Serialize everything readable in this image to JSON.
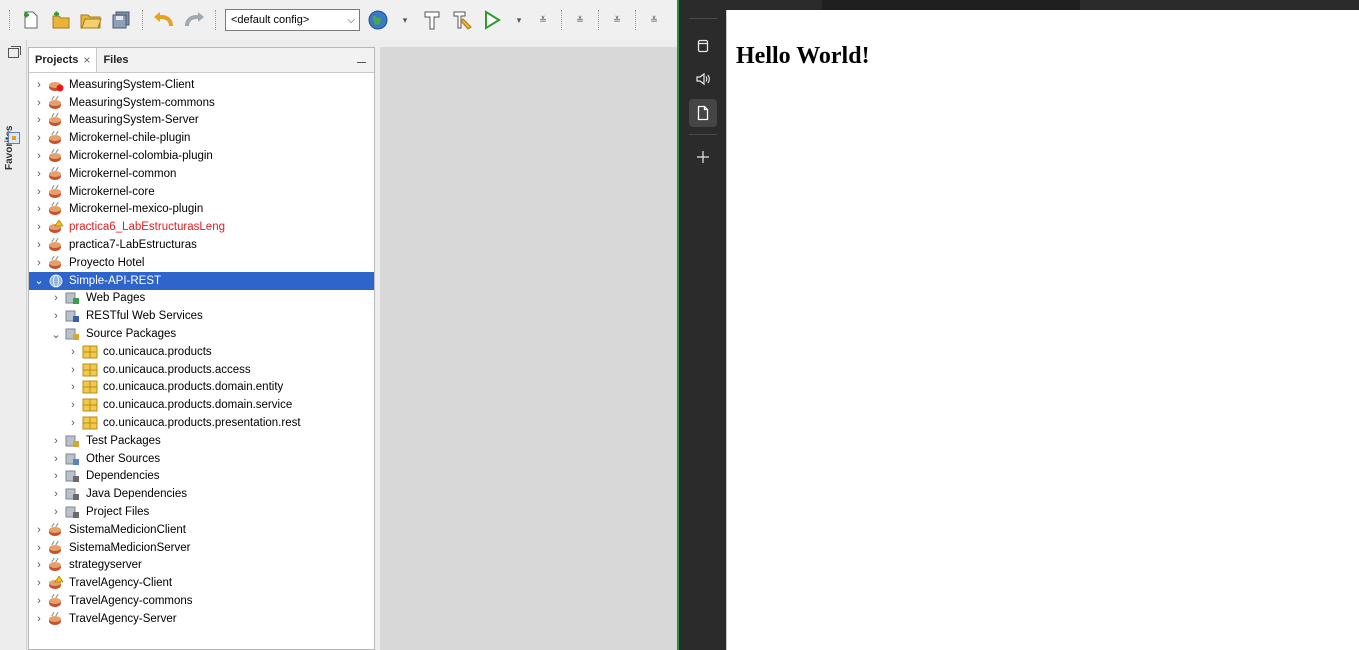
{
  "toolbar": {
    "config_value": "<default config>"
  },
  "favorites_label": "Favorites",
  "panel": {
    "tab_projects": "Projects",
    "tab_projects_close": "×",
    "tab_files": "Files"
  },
  "tree": [
    {
      "label": "MeasuringSystem-Client",
      "level": 0,
      "arrow": "›",
      "icon": "maven-project-error-icon",
      "state": ""
    },
    {
      "label": "MeasuringSystem-commons",
      "level": 0,
      "arrow": "›",
      "icon": "maven-project-icon",
      "state": ""
    },
    {
      "label": "MeasuringSystem-Server",
      "level": 0,
      "arrow": "›",
      "icon": "maven-project-icon",
      "state": ""
    },
    {
      "label": "Microkernel-chile-plugin",
      "level": 0,
      "arrow": "›",
      "icon": "maven-project-icon",
      "state": ""
    },
    {
      "label": "Microkernel-colombia-plugin",
      "level": 0,
      "arrow": "›",
      "icon": "maven-project-icon",
      "state": ""
    },
    {
      "label": "Microkernel-common",
      "level": 0,
      "arrow": "›",
      "icon": "maven-project-icon",
      "state": ""
    },
    {
      "label": "Microkernel-core",
      "level": 0,
      "arrow": "›",
      "icon": "maven-project-icon",
      "state": ""
    },
    {
      "label": "Microkernel-mexico-plugin",
      "level": 0,
      "arrow": "›",
      "icon": "maven-project-icon",
      "state": ""
    },
    {
      "label": "practica6_LabEstructurasLeng",
      "level": 0,
      "arrow": "›",
      "icon": "project-warning-icon",
      "state": "error"
    },
    {
      "label": "practica7-LabEstructuras",
      "level": 0,
      "arrow": "›",
      "icon": "maven-project-icon",
      "state": ""
    },
    {
      "label": "Proyecto Hotel",
      "level": 0,
      "arrow": "›",
      "icon": "maven-project-icon",
      "state": ""
    },
    {
      "label": "Simple-API-REST",
      "level": 0,
      "arrow": "⌄",
      "icon": "web-project-icon",
      "state": "selected"
    },
    {
      "label": "Web Pages",
      "level": 1,
      "arrow": "›",
      "icon": "web-pages-folder-icon",
      "state": ""
    },
    {
      "label": "RESTful Web Services",
      "level": 1,
      "arrow": "›",
      "icon": "rest-services-folder-icon",
      "state": ""
    },
    {
      "label": "Source Packages",
      "level": 1,
      "arrow": "⌄",
      "icon": "source-packages-folder-icon",
      "state": ""
    },
    {
      "label": "co.unicauca.products",
      "level": 2,
      "arrow": "›",
      "icon": "package-icon",
      "state": ""
    },
    {
      "label": "co.unicauca.products.access",
      "level": 2,
      "arrow": "›",
      "icon": "package-icon",
      "state": ""
    },
    {
      "label": "co.unicauca.products.domain.entity",
      "level": 2,
      "arrow": "›",
      "icon": "package-icon",
      "state": ""
    },
    {
      "label": "co.unicauca.products.domain.service",
      "level": 2,
      "arrow": "›",
      "icon": "package-icon",
      "state": ""
    },
    {
      "label": "co.unicauca.products.presentation.rest",
      "level": 2,
      "arrow": "›",
      "icon": "package-icon",
      "state": ""
    },
    {
      "label": "Test Packages",
      "level": 1,
      "arrow": "›",
      "icon": "test-packages-folder-icon",
      "state": ""
    },
    {
      "label": "Other Sources",
      "level": 1,
      "arrow": "›",
      "icon": "other-sources-folder-icon",
      "state": ""
    },
    {
      "label": "Dependencies",
      "level": 1,
      "arrow": "›",
      "icon": "dependencies-folder-icon",
      "state": ""
    },
    {
      "label": "Java Dependencies",
      "level": 1,
      "arrow": "›",
      "icon": "java-dependencies-folder-icon",
      "state": ""
    },
    {
      "label": "Project Files",
      "level": 1,
      "arrow": "›",
      "icon": "project-files-folder-icon",
      "state": ""
    },
    {
      "label": "SistemaMedicionClient",
      "level": 0,
      "arrow": "›",
      "icon": "maven-project-icon",
      "state": ""
    },
    {
      "label": "SistemaMedicionServer",
      "level": 0,
      "arrow": "›",
      "icon": "maven-project-icon",
      "state": ""
    },
    {
      "label": "strategyserver",
      "level": 0,
      "arrow": "›",
      "icon": "maven-project-icon",
      "state": ""
    },
    {
      "label": "TravelAgency-Client",
      "level": 0,
      "arrow": "›",
      "icon": "project-warning-icon",
      "state": ""
    },
    {
      "label": "TravelAgency-commons",
      "level": 0,
      "arrow": "›",
      "icon": "maven-project-icon",
      "state": ""
    },
    {
      "label": "TravelAgency-Server",
      "level": 0,
      "arrow": "›",
      "icon": "maven-project-icon",
      "state": ""
    }
  ],
  "browser": {
    "heading": "Hello World!"
  },
  "colors": {
    "selection": "#2f65ca",
    "error_text": "#e8191d",
    "browser_sidebar": "#2b2b2b",
    "edge_accent": "#2d8d3f"
  }
}
